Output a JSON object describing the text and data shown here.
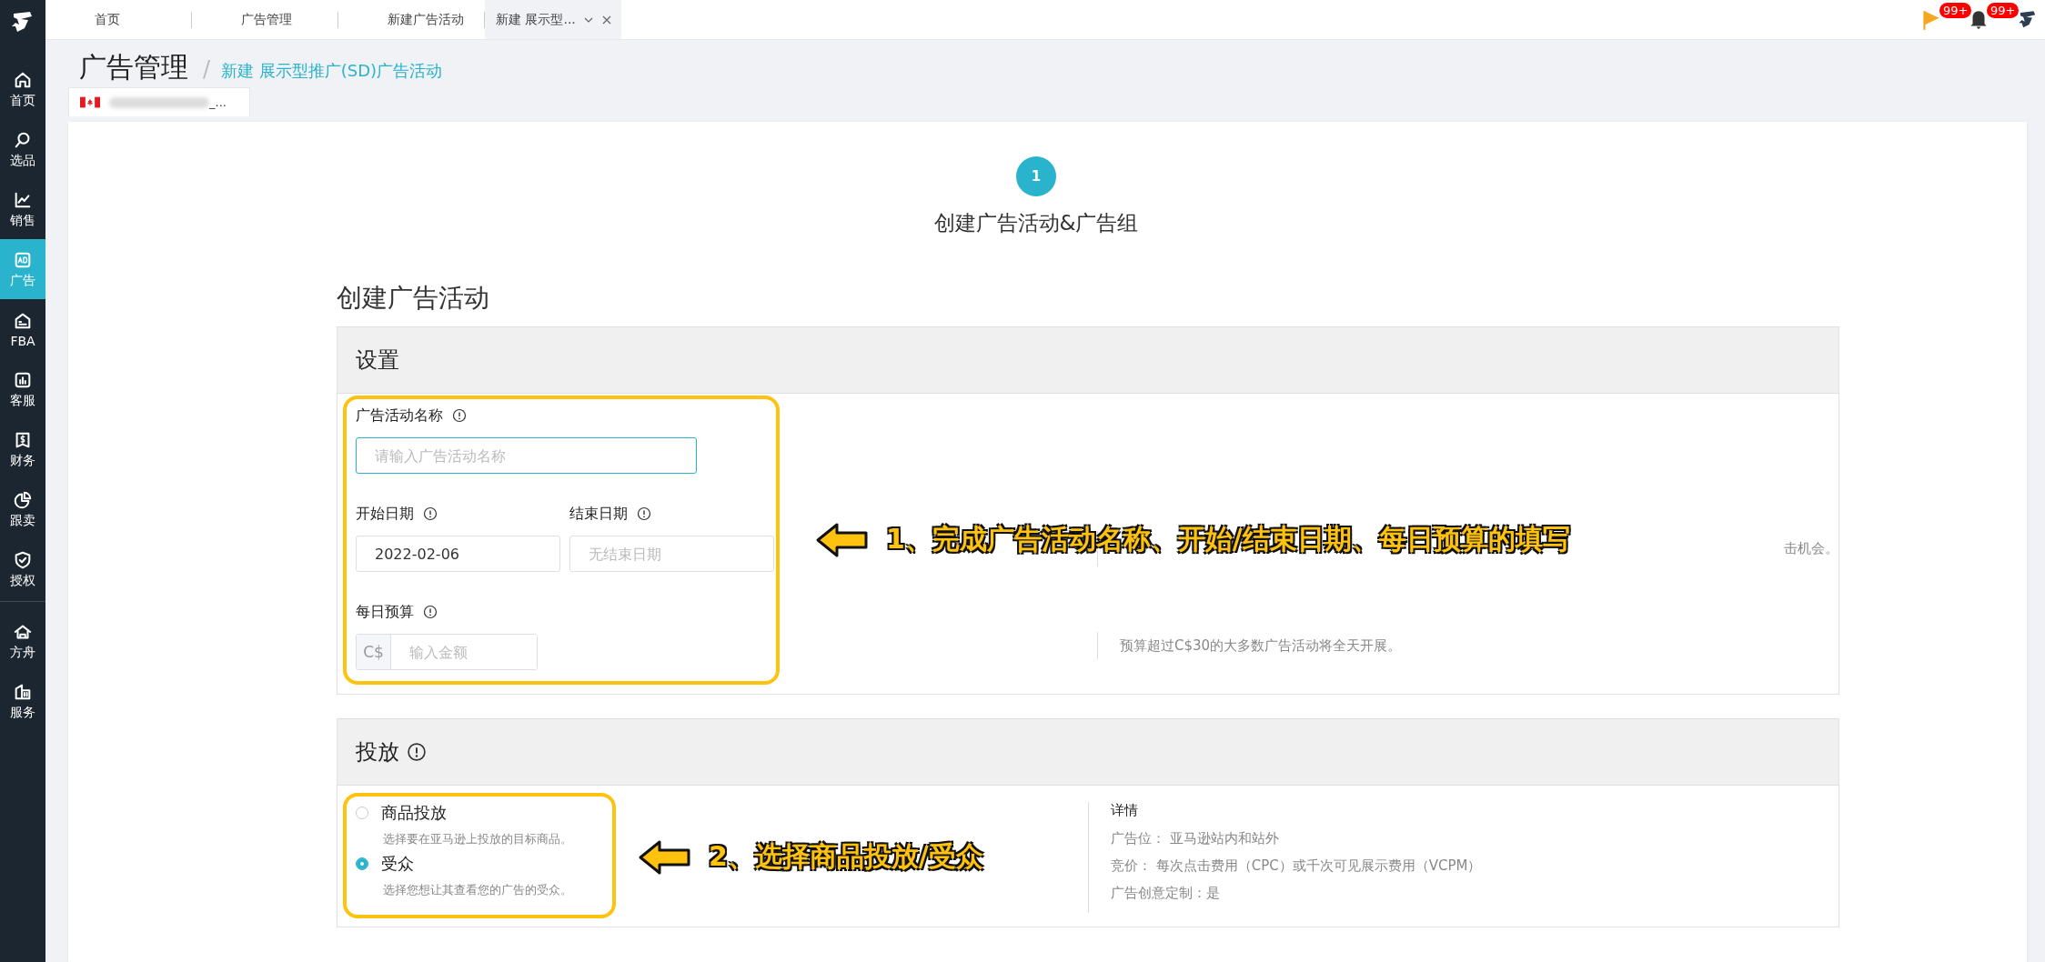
{
  "sidebar": {
    "items": [
      {
        "label": "首页",
        "selected": false
      },
      {
        "label": "选品",
        "selected": false
      },
      {
        "label": "销售",
        "selected": false
      },
      {
        "label": "广告",
        "selected": true
      },
      {
        "label": "FBA",
        "selected": false
      },
      {
        "label": "客服",
        "selected": false
      },
      {
        "label": "财务",
        "selected": false
      },
      {
        "label": "跟卖",
        "selected": false
      },
      {
        "label": "授权",
        "selected": false
      }
    ],
    "bottom_items": [
      {
        "label": "方舟",
        "selected": false
      },
      {
        "label": "服务",
        "selected": false
      }
    ]
  },
  "top_tabs": [
    {
      "label": "首页",
      "selected": false
    },
    {
      "label": "广告管理",
      "selected": false
    },
    {
      "label": "新建广告活动",
      "selected": false
    },
    {
      "label": "新建 展示型...",
      "selected": true
    }
  ],
  "notifications": [
    {
      "count": "99+"
    },
    {
      "count": "99+"
    }
  ],
  "header": {
    "title": "广告管理",
    "separator": "/",
    "breadcrumb": "新建 展示型推广(SD)广告活动"
  },
  "store_tab": {
    "label": "_..."
  },
  "steps": [
    {
      "number": "1",
      "label": "创建广告活动&广告组",
      "selected": true
    }
  ],
  "page_title": "创建广告活动",
  "settings": {
    "title": "设置",
    "name_field": {
      "label": "广告活动名称",
      "placeholder": "请输入广告活动名称"
    },
    "start_date": {
      "label": "开始日期",
      "value": "2022-02-06"
    },
    "end_date": {
      "label": "结束日期",
      "placeholder": "无结束日期"
    },
    "budget": {
      "label": "每日预算",
      "currency": "C$",
      "placeholder": "输入金额"
    },
    "hints": [
      "击机会。",
      "预算超过C$30的大多数广告活动将全天开展。"
    ]
  },
  "targeting": {
    "title": "投放",
    "options": [
      {
        "label": "商品投放",
        "description": "选择要在亚马逊上投放的目标商品。",
        "selected": false
      },
      {
        "label": "受众",
        "description": "选择您想让其查看您的广告的受众。",
        "selected": true
      }
    ],
    "details": {
      "title": "详情",
      "lines": [
        "广告位： 亚马逊站内和站外",
        "竞价： 每次点击费用（CPC）或千次可见展示费用（VCPM）",
        "广告创意定制：是"
      ]
    }
  },
  "annotations": [
    "1、完成广告活动名称、开始/结束日期、每日预算的填写",
    "2、选择商品投放/受众"
  ]
}
